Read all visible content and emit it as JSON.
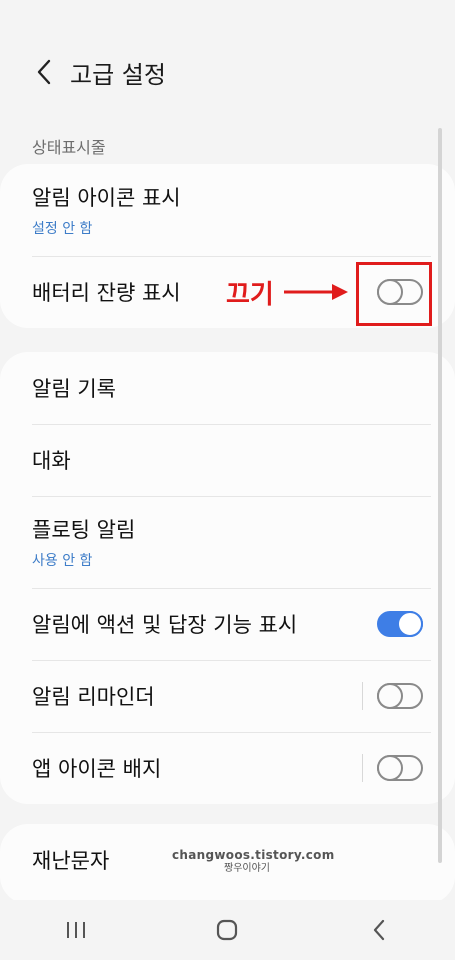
{
  "header": {
    "title": "고급 설정"
  },
  "section": {
    "label": "상태표시줄"
  },
  "card1": {
    "rows": [
      {
        "title": "알림 아이콘 표시",
        "sub": "설정 안 함"
      },
      {
        "title": "배터리 잔량 표시",
        "toggle": "off"
      }
    ]
  },
  "card2": {
    "rows": [
      {
        "title": "알림 기록"
      },
      {
        "title": "대화"
      },
      {
        "title": "플로팅 알림",
        "sub": "사용 안 함"
      },
      {
        "title": "알림에 액션 및 답장 기능 표시",
        "toggle": "on"
      },
      {
        "title": "알림 리마인더",
        "toggle": "off"
      },
      {
        "title": "앱 아이콘 배지",
        "toggle": "off"
      }
    ]
  },
  "card3": {
    "rows": [
      {
        "title": "재난문자"
      }
    ]
  },
  "annotation": {
    "text": "끄기",
    "color": "#e01c1c"
  },
  "watermark": {
    "line1": "changwoos.tistory.com",
    "line2": "짱우이야기"
  },
  "colors": {
    "accent": "#3e7ee6",
    "link": "#3e7dc8"
  },
  "navbar": {
    "icons": [
      "recent-apps-icon",
      "home-icon",
      "back-icon"
    ]
  }
}
